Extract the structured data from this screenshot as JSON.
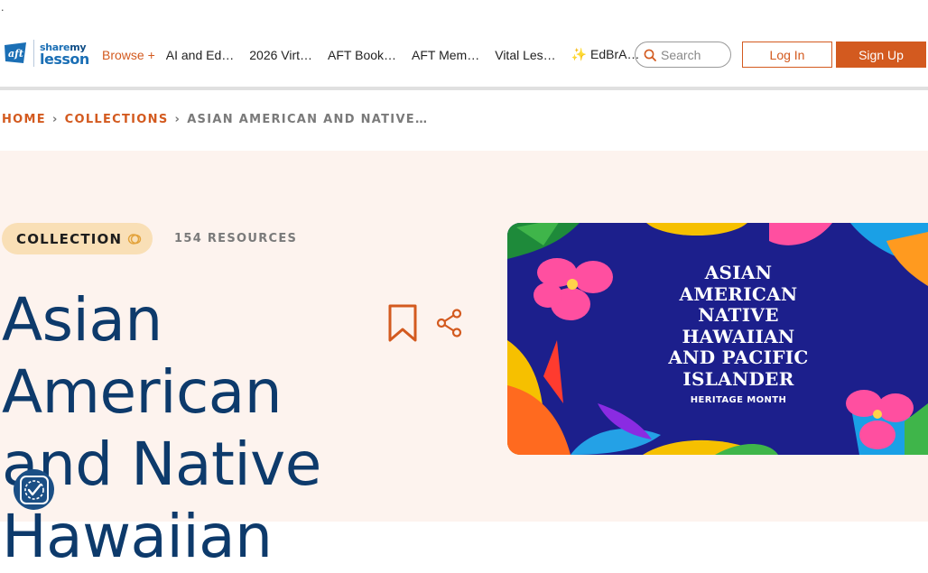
{
  "page": {
    "marker": "."
  },
  "header": {
    "logo": {
      "brand_mark": "aft",
      "line1_a": "share",
      "line1_b": "my",
      "line2": "lesson"
    },
    "nav": {
      "browse_label": "Browse +",
      "items": [
        "AI and Ed…",
        "2026 Virt…",
        "AFT Book…",
        "AFT Mem…",
        "Vital Les…",
        "✨ EdBrA…"
      ]
    },
    "search": {
      "placeholder": "Search"
    },
    "login_label": "Log In",
    "signup_label": "Sign Up"
  },
  "breadcrumb": {
    "home": "HOME",
    "collections": "COLLECTIONS",
    "current": "ASIAN AMERICAN AND NATIVE…",
    "separator": "›"
  },
  "hero": {
    "badge_label": "COLLECTION",
    "resource_count": "154 RESOURCES",
    "title": "Asian American and Native Hawaiian",
    "banner": {
      "main_text": "ASIAN\nAMERICAN\nNATIVE\nHAWAIIAN\nAND PACIFIC\nISLANDER",
      "sub_text": "HERITAGE MONTH"
    }
  },
  "colors": {
    "accent": "#d35a1f",
    "brand_blue": "#0d3a6b",
    "hero_bg": "#fdf3ee",
    "badge_bg": "#f9dfb6",
    "banner_bg": "#1c1f8c"
  },
  "icons": [
    "search-icon",
    "bookmark-icon",
    "share-icon",
    "collection-rings-icon",
    "accessibility-icon"
  ]
}
